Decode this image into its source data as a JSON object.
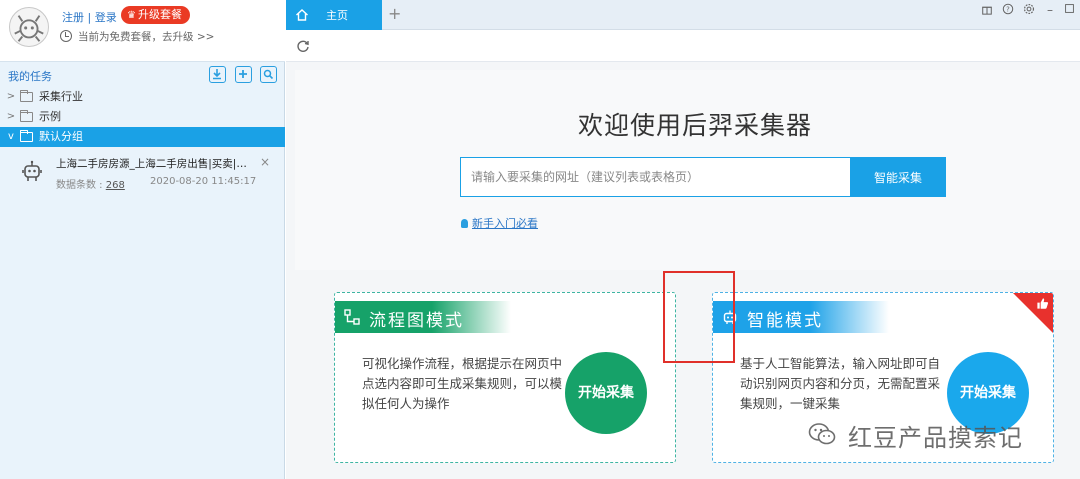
{
  "user": {
    "register_label": "注册",
    "separator": "|",
    "login_label": "登录",
    "upgrade_label": "升级套餐",
    "plan_text": "当前为免费套餐，去升级 >>"
  },
  "tasks": {
    "title": "我的任务",
    "folders": [
      {
        "label": "采集行业",
        "expanded": false
      },
      {
        "label": "示例",
        "expanded": false
      },
      {
        "label": "默认分组",
        "expanded": true
      }
    ],
    "item": {
      "name": "上海二手房房源_上海二手房出售|买卖|交易...",
      "count_label": "数据条数 :",
      "count": "268",
      "time": "2020-08-20 11:45:17"
    }
  },
  "tabs": [
    {
      "label": "主页",
      "active": true
    }
  ],
  "hero": {
    "title": "欢迎使用后羿采集器",
    "url_placeholder": "请输入要采集的网址（建议列表或表格页）",
    "smart_button": "智能采集",
    "guide_link": "新手入门必看"
  },
  "cards": {
    "flow": {
      "title": "流程图模式",
      "description": "可视化操作流程，根据提示在网页中点选内容即可生成采集规则，可以模拟任何人为操作",
      "button": "开始采集"
    },
    "smart": {
      "title": "智能模式",
      "description": "基于人工智能算法，输入网址即可自动识别网页内容和分页，无需配置采集规则，一键采集",
      "button": "开始采集"
    }
  },
  "watermark": {
    "text": "红豆产品摸索记"
  },
  "colors": {
    "accent_blue": "#1aa1e6",
    "flow_green": "#16a269",
    "upgrade_red": "#ea3a24",
    "highlight_red": "#e0302a"
  }
}
